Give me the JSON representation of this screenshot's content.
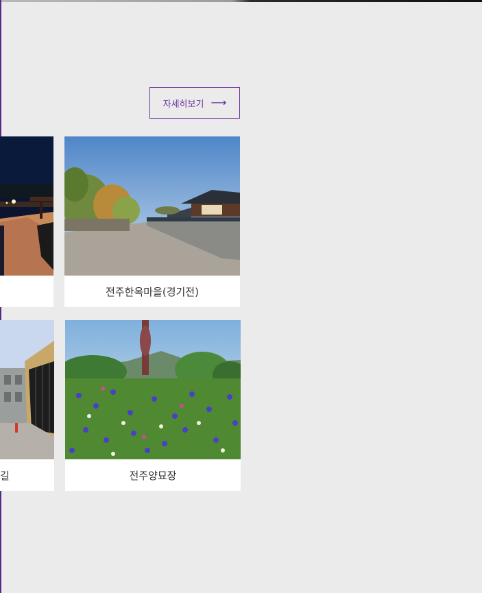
{
  "header": {
    "more_button": {
      "label": "자세히보기",
      "arrow_icon": "long-arrow-right-icon",
      "accent_color": "#6b2fa0"
    }
  },
  "cards": [
    {
      "id": "night-walkway",
      "label": "",
      "image": "night-walkway-photo"
    },
    {
      "id": "hanok-village",
      "label": "전주한옥마을(경기전)",
      "image": "hanok-village-wall-photo"
    },
    {
      "id": "alley-street",
      "label": "길",
      "image": "alley-buildings-photo"
    },
    {
      "id": "yangmyojang",
      "label": "전주양묘장",
      "image": "cornflower-field-photo"
    }
  ]
}
